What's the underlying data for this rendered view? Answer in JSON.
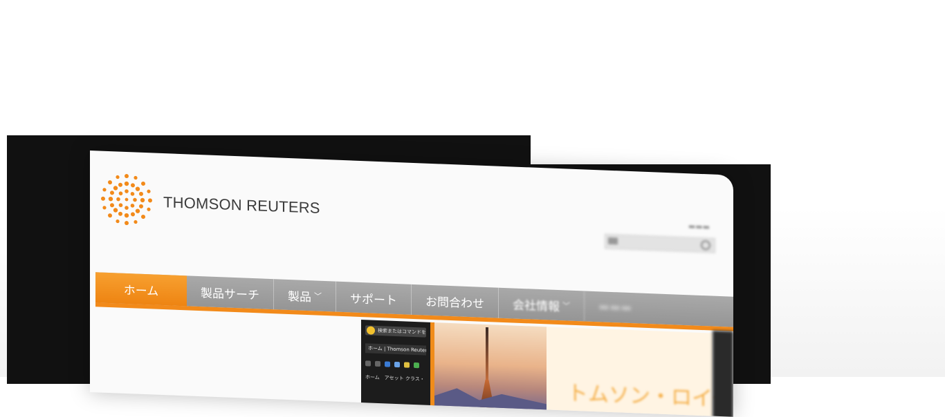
{
  "brand": {
    "name": "THOMSON REUTERS",
    "accent": "#F28A1A",
    "nav_grey": "#9E9E9E"
  },
  "header": {
    "logo_text": "THOMSON REUTERS"
  },
  "nav": {
    "items": [
      {
        "label": "ホーム",
        "active": true
      },
      {
        "label": "製品サーチ"
      },
      {
        "label": "製品",
        "chevron": "chevron-down-icon"
      },
      {
        "label": "サポート"
      },
      {
        "label": "お問合わせ"
      },
      {
        "label": "会社情報",
        "chevron": "chevron-down-icon"
      }
    ]
  },
  "hero": {
    "addr_text": "検索またはコマンドを入力",
    "tab_text": "ホーム | Thomson Reuters",
    "menu_text": "ホーム　アセット クラス・",
    "heading": "トムソン・ロイター"
  }
}
